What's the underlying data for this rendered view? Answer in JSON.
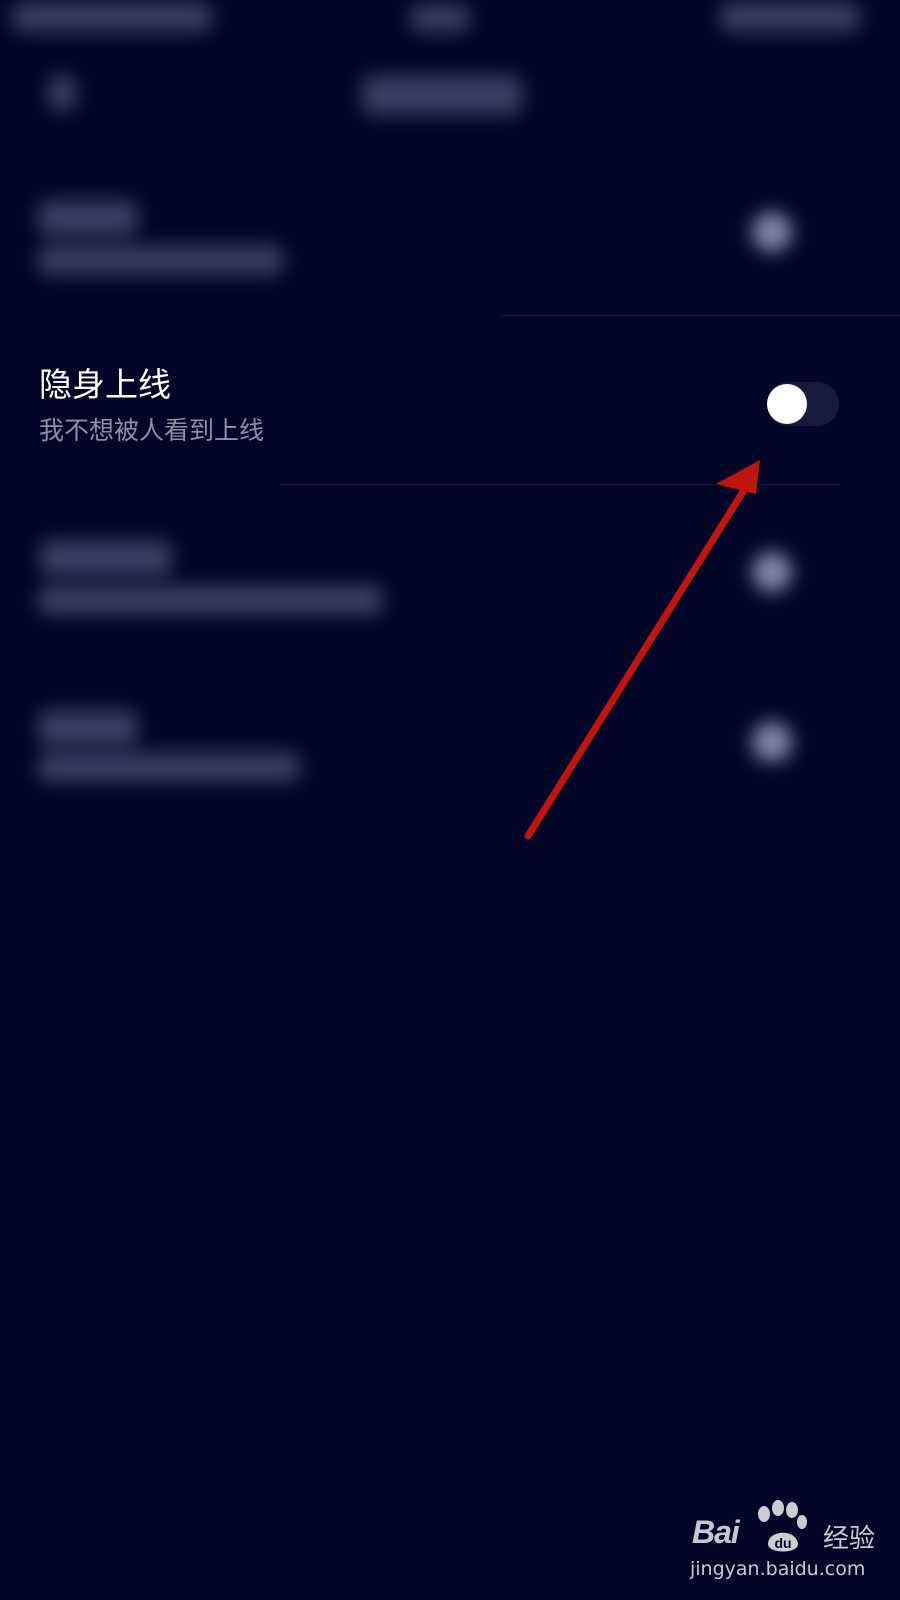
{
  "setting": {
    "title": "隐身上线",
    "description": "我不想被人看到上线",
    "toggle_state": "off"
  },
  "watermark": {
    "brand": "Bai",
    "brand_tail": "",
    "product": "经验",
    "url": "jingyan.baidu.com"
  },
  "colors": {
    "background": "#020727",
    "annotation_arrow": "#c0140f",
    "toggle_track": "#161c3a",
    "toggle_knob": "#ffffff"
  },
  "icons": {
    "annotation": "arrow-annotation",
    "watermark": "baidu-paw-icon"
  }
}
